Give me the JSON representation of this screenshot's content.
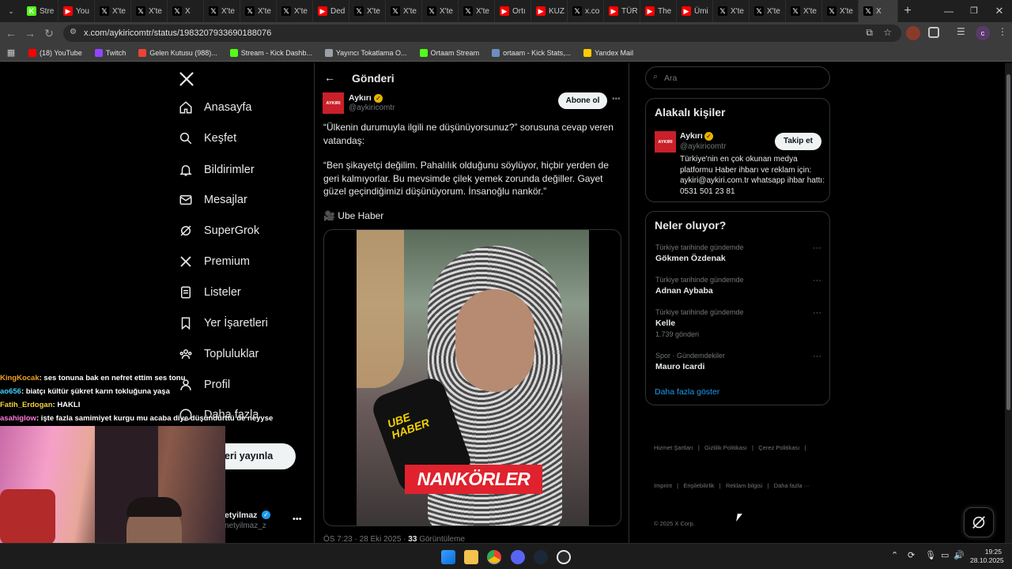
{
  "browser": {
    "tabs": [
      {
        "label": "Stre",
        "icon": "kick-icon",
        "color": "#53fc18"
      },
      {
        "label": "You",
        "icon": "youtube-icon",
        "color": "#ff0000"
      },
      {
        "label": "X'te",
        "icon": "x-icon",
        "color": "#000000"
      },
      {
        "label": "X'te",
        "icon": "x-icon",
        "color": "#000000"
      },
      {
        "label": "X",
        "icon": "x-icon",
        "color": "#000000"
      },
      {
        "label": "X'te",
        "icon": "x-icon",
        "color": "#000000"
      },
      {
        "label": "X'te",
        "icon": "x-icon",
        "color": "#000000"
      },
      {
        "label": "X'te",
        "icon": "x-icon",
        "color": "#000000"
      },
      {
        "label": "Ded",
        "icon": "youtube-icon",
        "color": "#ff0000"
      },
      {
        "label": "X'te",
        "icon": "x-icon",
        "color": "#000000"
      },
      {
        "label": "X'te",
        "icon": "x-icon",
        "color": "#000000"
      },
      {
        "label": "X'te",
        "icon": "x-icon",
        "color": "#000000"
      },
      {
        "label": "X'te",
        "icon": "x-icon",
        "color": "#000000"
      },
      {
        "label": "Ortı",
        "icon": "youtube-icon",
        "color": "#ff0000"
      },
      {
        "label": "KUZ",
        "icon": "youtube-icon",
        "color": "#ff0000"
      },
      {
        "label": "x.co",
        "icon": "x-icon",
        "color": "#000000"
      },
      {
        "label": "TÜR",
        "icon": "youtube-icon",
        "color": "#ff0000"
      },
      {
        "label": "The",
        "icon": "youtube-icon",
        "color": "#ff0000"
      },
      {
        "label": "Ümi",
        "icon": "youtube-icon",
        "color": "#ff0000"
      },
      {
        "label": "X'te",
        "icon": "x-icon",
        "color": "#000000"
      },
      {
        "label": "X'te",
        "icon": "x-icon",
        "color": "#000000"
      },
      {
        "label": "X'te",
        "icon": "x-icon",
        "color": "#000000"
      },
      {
        "label": "X'te",
        "icon": "x-icon",
        "color": "#000000"
      },
      {
        "label": "X",
        "icon": "x-icon",
        "color": "#000000",
        "active": true
      }
    ],
    "url": "x.com/aykiricomtr/status/1983207933690188076",
    "bookmarks": [
      {
        "label": "(18) YouTube",
        "color": "#ff0000"
      },
      {
        "label": "Twitch",
        "color": "#9146ff"
      },
      {
        "label": "Gelen Kutusu (988)...",
        "color": "#ea4335"
      },
      {
        "label": "Stream - Kick Dashb...",
        "color": "#53fc18"
      },
      {
        "label": "Yayıncı Tokatlama O...",
        "color": "#9aa0a6"
      },
      {
        "label": "Ortaam Stream",
        "color": "#53fc18"
      },
      {
        "label": "ortaam - Kick Stats,...",
        "color": "#6c8ebf"
      },
      {
        "label": "Yandex Mail",
        "color": "#ffcc00"
      }
    ]
  },
  "nav": {
    "items": [
      {
        "label": "Anasayfa",
        "icon": "home-icon"
      },
      {
        "label": "Keşfet",
        "icon": "search-icon"
      },
      {
        "label": "Bildirimler",
        "icon": "bell-icon"
      },
      {
        "label": "Mesajlar",
        "icon": "mail-icon"
      },
      {
        "label": "SuperGrok",
        "icon": "grok-icon"
      },
      {
        "label": "Premium",
        "icon": "x-icon"
      },
      {
        "label": "Listeler",
        "icon": "list-icon"
      },
      {
        "label": "Yer İşaretleri",
        "icon": "bookmark-icon"
      },
      {
        "label": "Topluluklar",
        "icon": "community-icon"
      },
      {
        "label": "Profil",
        "icon": "user-icon"
      },
      {
        "label": "Daha fazla",
        "icon": "more-circle-icon"
      }
    ],
    "post_button": "eri yayınla",
    "account_name": "etyilmaz",
    "account_handle": "netyilmaz_z"
  },
  "post": {
    "header": "Gönderi",
    "author_name": "Aykırı",
    "author_handle": "@aykiricomtr",
    "avatar_text": "AYKIRI",
    "subscribe_label": "Abone ol",
    "paragraph1": "“Ülkenin durumuyla ilgili ne düşünüyorsunuz?” sorusuna cevap veren vatandaş:",
    "paragraph2": "“Ben şikayetçi değilim. Pahalılık olduğunu söylüyor, hiçbir yerden de geri kalmıyorlar. Bu mevsimde çilek yemek zorunda değiller. Gayet güzel geçindiğimizi düşünüyorum. İnsanoğlu nankör.”",
    "source": "🎥 Ube Haber",
    "video_caption": "NANKÖRLER",
    "mic_text": "UBE HABER",
    "meta_time": "ÖS 7:23 · 28 Eki 2025 ·",
    "views_count": "33",
    "views_label": "Görüntüleme"
  },
  "right": {
    "search_placeholder": "Ara",
    "related_title": "Alakalı kişiler",
    "related_name": "Aykırı",
    "related_handle": "@aykiricomtr",
    "follow_label": "Takip et",
    "related_bio": "Türkiye'nin en çok okunan medya platformu Haber ihbarı ve reklam için: aykiri@aykiri.com.tr whatsapp ihbar hattı: 0531 501 23 81",
    "trends_title": "Neler oluyor?",
    "trends": [
      {
        "sub": "Türkiye tarihinde gündemde",
        "name": "Gökmen Özdenak",
        "count": ""
      },
      {
        "sub": "Türkiye tarihinde gündemde",
        "name": "Adnan Aybaba",
        "count": ""
      },
      {
        "sub": "Türkiye tarihinde gündemde",
        "name": "Kelle",
        "count": "1.739 gönderi"
      },
      {
        "sub": "Spor · Gündemdekiler",
        "name": "Mauro Icardi",
        "count": ""
      }
    ],
    "show_more": "Daha fazla göster",
    "footer_line1": "Hizmet Şartları   |   Gizlilik Politikası   |   Çerez Politikası   |",
    "footer_line2": "Imprint   |   Erişilebilirlik   |   Reklam bilgisi   |   Daha fazla ···",
    "footer_line3": "© 2025 X Corp."
  },
  "chat": [
    {
      "user": "KingKocak",
      "color": "#f0a020",
      "msg": ": ses tonuna bak en nefret ettim ses tonu"
    },
    {
      "user": "ao656",
      "color": "#40d0ff",
      "msg": ": biatçı kültür şükret karın tokluğuna yaşa"
    },
    {
      "user": "Fatih_Erdogan",
      "color": "#f7d13c",
      "msg": ": HAKLI"
    },
    {
      "user": "asahiglow",
      "color": "#ff7ad9",
      "msg": ": işte fazla samimiyet kurgu mu acaba diye düşündürttü de neyyse"
    }
  ],
  "taskbar": {
    "time": "19:25",
    "date": "28.10.2025"
  }
}
